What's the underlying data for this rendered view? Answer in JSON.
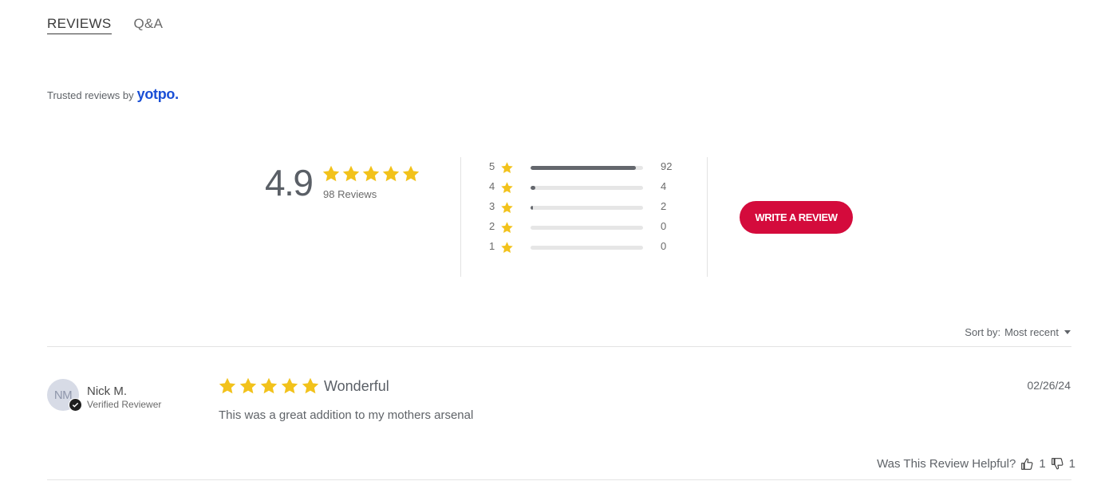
{
  "tabs": [
    {
      "label": "REVIEWS",
      "active": true
    },
    {
      "label": "Q&A",
      "active": false
    }
  ],
  "trusted": {
    "prefix": "Trusted reviews by",
    "brand": "yotpo."
  },
  "summary": {
    "average": "4.9",
    "average_stars": 5,
    "count_label": "98 Reviews",
    "distribution": [
      {
        "stars": "5",
        "count": "92",
        "fraction": 0.939
      },
      {
        "stars": "4",
        "count": "4",
        "fraction": 0.041
      },
      {
        "stars": "3",
        "count": "2",
        "fraction": 0.02
      },
      {
        "stars": "2",
        "count": "0",
        "fraction": 0
      },
      {
        "stars": "1",
        "count": "0",
        "fraction": 0
      }
    ]
  },
  "write_review_label": "WRITE A REVIEW",
  "sort": {
    "label": "Sort by:",
    "value": "Most recent"
  },
  "reviews": [
    {
      "initials": "NM",
      "name": "Nick M.",
      "badge": "Verified Reviewer",
      "rating": 5,
      "title": "Wonderful",
      "date": "02/26/24",
      "body": "This was a great addition to my mothers arsenal",
      "helpful_label": "Was This Review Helpful?",
      "up_votes": "1",
      "down_votes": "1"
    }
  ],
  "colors": {
    "accent": "#d40b3c",
    "star": "#f2c21b",
    "brand": "#1a4fd6",
    "bar_fill": "#64676d"
  }
}
